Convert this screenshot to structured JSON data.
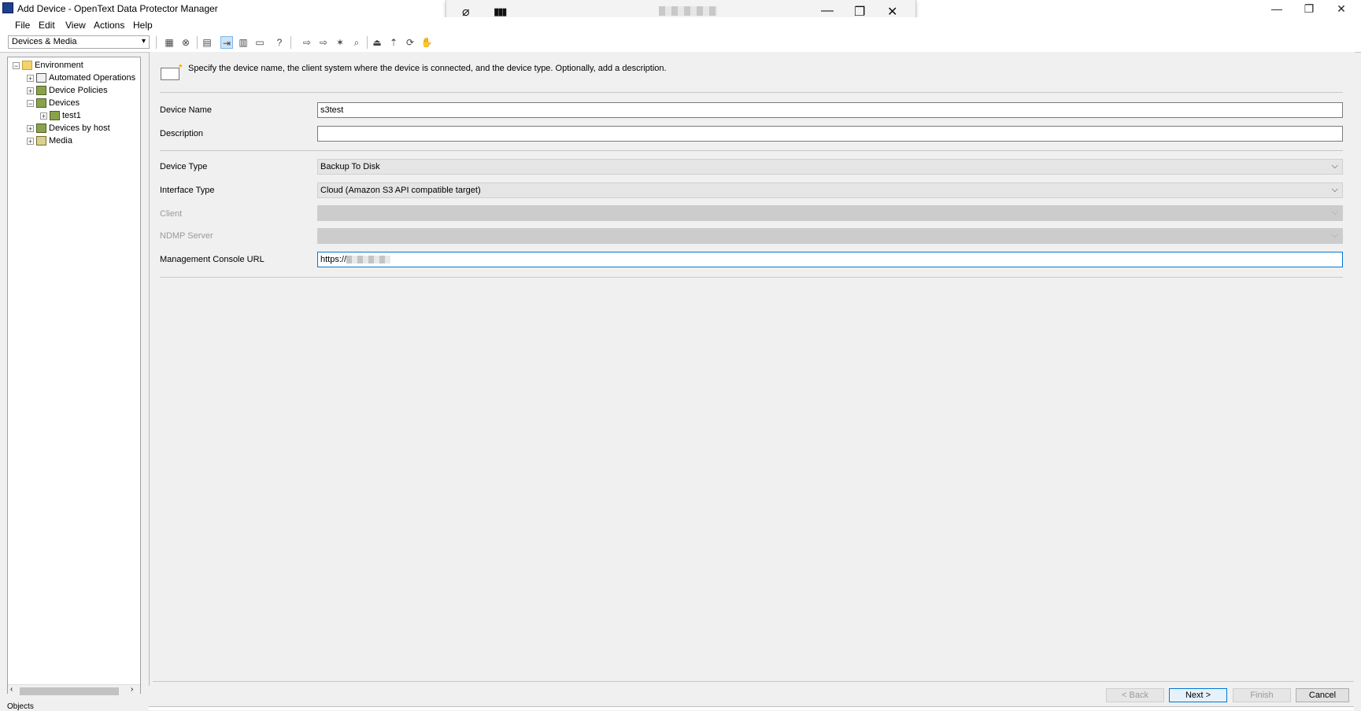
{
  "window": {
    "title": "Add Device - OpenText Data Protector Manager",
    "minimize": "—",
    "restore": "❐",
    "close": "✕"
  },
  "remote_bar": {
    "pin": "⌀",
    "signal": "▮▮▮",
    "minimize": "—",
    "restore": "❐",
    "close": "✕"
  },
  "menu": {
    "items": [
      "File",
      "Edit",
      "View",
      "Actions",
      "Help"
    ]
  },
  "toolbar": {
    "context": "Devices & Media",
    "help": "?"
  },
  "tree": {
    "items": [
      {
        "label": "Environment",
        "icon": "folder-icon"
      },
      {
        "label": "Automated Operations",
        "icon": "operations-icon"
      },
      {
        "label": "Device Policies",
        "icon": "device-icon"
      },
      {
        "label": "Devices",
        "icon": "device-icon"
      },
      {
        "label": "test1",
        "icon": "device-icon"
      },
      {
        "label": "Devices by host",
        "icon": "device-icon"
      },
      {
        "label": "Media",
        "icon": "media-icon"
      }
    ],
    "bottom_tab": "Objects"
  },
  "wizard": {
    "instruction": "Specify the device name, the client system where the device is connected, and the device type. Optionally, add a description.",
    "fields": {
      "device_name": {
        "label": "Device Name",
        "value": "s3test"
      },
      "description": {
        "label": "Description",
        "value": ""
      },
      "device_type": {
        "label": "Device Type",
        "value": "Backup To Disk"
      },
      "interface_type": {
        "label": "Interface Type",
        "value": "Cloud (Amazon S3 API compatible target)"
      },
      "client": {
        "label": "Client",
        "value": ""
      },
      "ndmp_server": {
        "label": "NDMP Server",
        "value": ""
      },
      "console_url": {
        "label": "Management Console URL",
        "value": "https://"
      }
    },
    "buttons": {
      "back": "< Back",
      "next": "Next >",
      "finish": "Finish",
      "cancel": "Cancel"
    }
  }
}
